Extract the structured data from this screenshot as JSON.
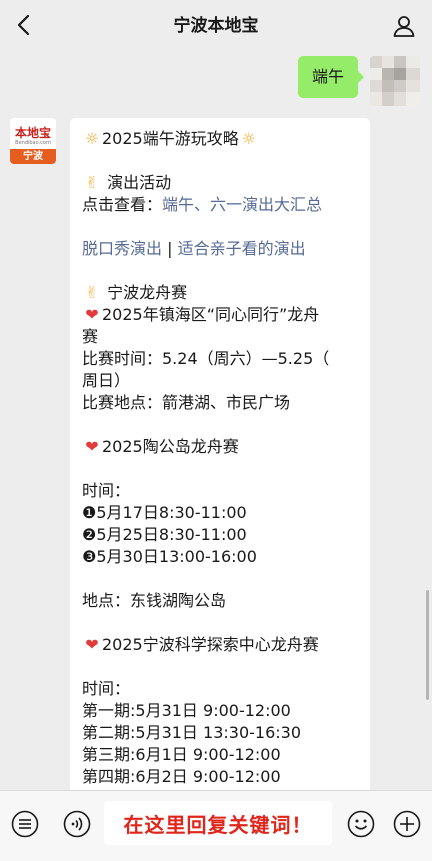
{
  "header": {
    "title": "宁波本地宝"
  },
  "outgoing": {
    "text": "端午"
  },
  "bot": {
    "logo_top": "本地宝",
    "logo_url": "Bendibao.com",
    "logo_city": "宁波"
  },
  "message": {
    "line1": "2025端午游玩攻略",
    "line2": "演出活动",
    "line3_prefix": "点击查看：",
    "line3_link": "端午、六一演出大汇总",
    "line4_link1": "脱口秀演出",
    "line4_sep": " | ",
    "line4_link2": "适合亲子看的演出",
    "line5": "宁波龙舟赛",
    "line6": "2025年镇海区“同心同行”龙舟",
    "line7": "赛",
    "line8": "比赛时间：5.24（周六）—5.25（",
    "line9": "周日）",
    "line10": "比赛地点：箭港湖、市民广场",
    "line11": "2025陶公岛龙舟赛",
    "line12": "时间：",
    "line13": "❶5月17日8:30-11:00",
    "line14": "❷5月25日8:30-11:00",
    "line15": "❸5月30日13:00-16:00",
    "line16": "地点：东钱湖陶公岛",
    "line17": "2025宁波科学探索中心龙舟赛",
    "line18": "时间：",
    "line19": "第一期:5月31日 9:00-12:00",
    "line20": "第二期:5月31日 13:30-16:30",
    "line21": "第三期:6月1日 9:00-12:00",
    "line22": "第四期:6月2日 9:00-12:00"
  },
  "input": {
    "hint": "在这里回复关键词！"
  },
  "colors": {
    "link": "#576b95",
    "bubble_out": "#95ec69",
    "hint": "#e0261b"
  }
}
